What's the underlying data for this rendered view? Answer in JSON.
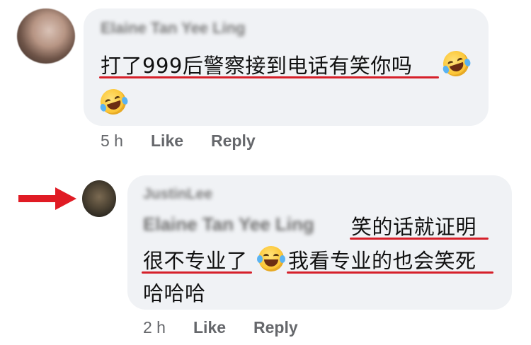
{
  "comments": [
    {
      "author": "Elaine Tan Yee Ling",
      "text": "打了999后警察接到电话有笑你吗",
      "emoji": "rolling-on-floor-laughing",
      "time": "5 h",
      "like": "Like",
      "reply": "Reply"
    },
    {
      "author": "JustinLee",
      "mention": "Elaine Tan Yee Ling",
      "text_line1": "笑的话就证明",
      "text_line2a": "很不专业了",
      "emoji": "face-with-tears-of-joy",
      "text_line2b": "我看专业的也会笑死",
      "text_line3": "哈哈哈",
      "time": "2 h",
      "like": "Like",
      "reply": "Reply"
    }
  ],
  "colors": {
    "bubble": "#f0f2f5",
    "underline": "#d6202a",
    "arrow": "#e01b24",
    "meta": "#65676b"
  }
}
